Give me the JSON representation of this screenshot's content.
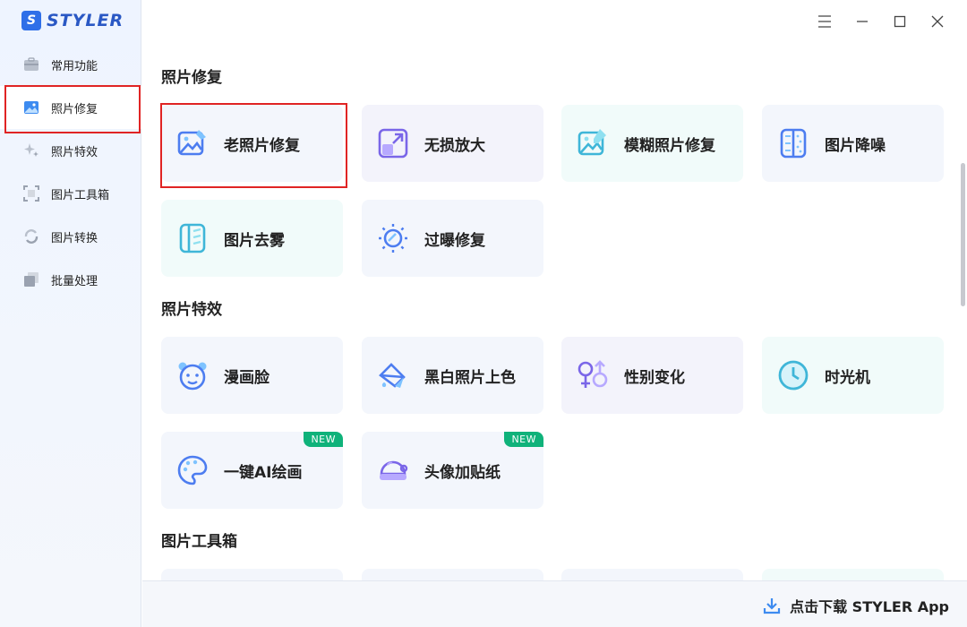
{
  "app": {
    "logo_mark": "S",
    "logo_text": "STYLER"
  },
  "sidebar": {
    "items": [
      {
        "label": "常用功能",
        "icon": "toolbox-icon"
      },
      {
        "label": "照片修复",
        "icon": "photo-icon",
        "active": true
      },
      {
        "label": "照片特效",
        "icon": "sparkle-icon"
      },
      {
        "label": "图片工具箱",
        "icon": "crop-frame-icon"
      },
      {
        "label": "图片转换",
        "icon": "convert-icon"
      },
      {
        "label": "批量处理",
        "icon": "stack-icon"
      }
    ]
  },
  "window_controls": {
    "menu": "menu-icon",
    "minimize": "minimize-icon",
    "maximize": "maximize-icon",
    "close": "close-icon"
  },
  "sections": [
    {
      "title": "照片修复",
      "cards": [
        {
          "label": "老照片修复",
          "icon": "old-photo-repair-icon",
          "highlight": true
        },
        {
          "label": "无损放大",
          "icon": "enlarge-icon"
        },
        {
          "label": "模糊照片修复",
          "icon": "blur-repair-icon"
        },
        {
          "label": "图片降噪",
          "icon": "denoise-icon"
        },
        {
          "label": "图片去雾",
          "icon": "dehaze-icon"
        },
        {
          "label": "过曝修复",
          "icon": "overexposure-icon"
        }
      ]
    },
    {
      "title": "照片特效",
      "cards": [
        {
          "label": "漫画脸",
          "icon": "cartoon-face-icon"
        },
        {
          "label": "黑白照片上色",
          "icon": "colorize-icon"
        },
        {
          "label": "性别变化",
          "icon": "gender-icon"
        },
        {
          "label": "时光机",
          "icon": "clock-icon"
        },
        {
          "label": "一键AI绘画",
          "icon": "palette-icon",
          "badge": "NEW"
        },
        {
          "label": "头像加贴纸",
          "icon": "sticker-icon",
          "badge": "NEW"
        }
      ]
    },
    {
      "title": "图片工具箱",
      "cards": []
    }
  ],
  "footer": {
    "download_label": "点击下载 STYLER App",
    "icon": "download-icon"
  },
  "colors": {
    "accent": "#2f6fe8",
    "highlight": "#e02424",
    "badge": "#0fb27a"
  }
}
